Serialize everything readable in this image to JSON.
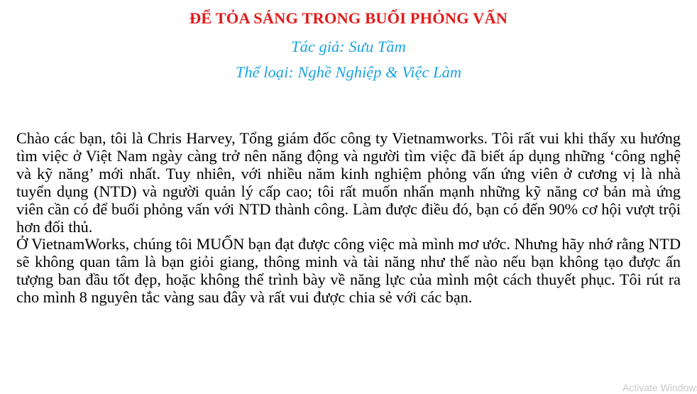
{
  "document": {
    "title": "ĐỂ TỎA SÁNG TRONG BUỔI PHỎNG VẤN",
    "author_line": "Tác giả: Sưu Tầm",
    "genre_line": "Thể loại: Nghề Nghiệp & Việc Làm",
    "paragraphs": [
      "Chào các bạn, tôi là Chris Harvey, Tổng giám đốc công ty Vietnamworks. Tôi rất vui khi thấy xu hướng tìm việc ở Việt Nam ngày càng trở nên năng động và người tìm việc đã biết áp dụng những ‘công nghệ và kỹ năng’ mới nhất. Tuy nhiên, với nhiều năm kinh nghiệm phỏng vấn ứng viên ở cương vị là nhà tuyển dụng (NTD) và người quản lý cấp cao; tôi rất muốn nhấn mạnh những kỹ năng cơ bản mà ứng viên cần có để buổi phỏng vấn với NTD thành công. Làm được điều đó, bạn có đến 90% cơ hội vượt trội hơn đối thủ.",
      "Ở VietnamWorks, chúng tôi MUỐN bạn đạt được công việc mà mình mơ ước. Nhưng hãy nhớ rằng NTD sẽ không quan tâm là bạn giỏi giang, thông minh và tài năng như thế nào nếu bạn không tạo được ấn tượng ban đầu tốt đẹp, hoặc không thể trình bày về năng lực của mình một cách thuyết phục. Tôi rút ra cho mình 8 nguyên tắc vàng sau đây và rất vui được chia sẻ với các bạn."
    ]
  },
  "overlay": {
    "watermark": "Activate Windows"
  },
  "colors": {
    "title": "#e21b1b",
    "meta": "#1aa3e0",
    "body": "#000000",
    "watermark": "#c8c8c8"
  }
}
